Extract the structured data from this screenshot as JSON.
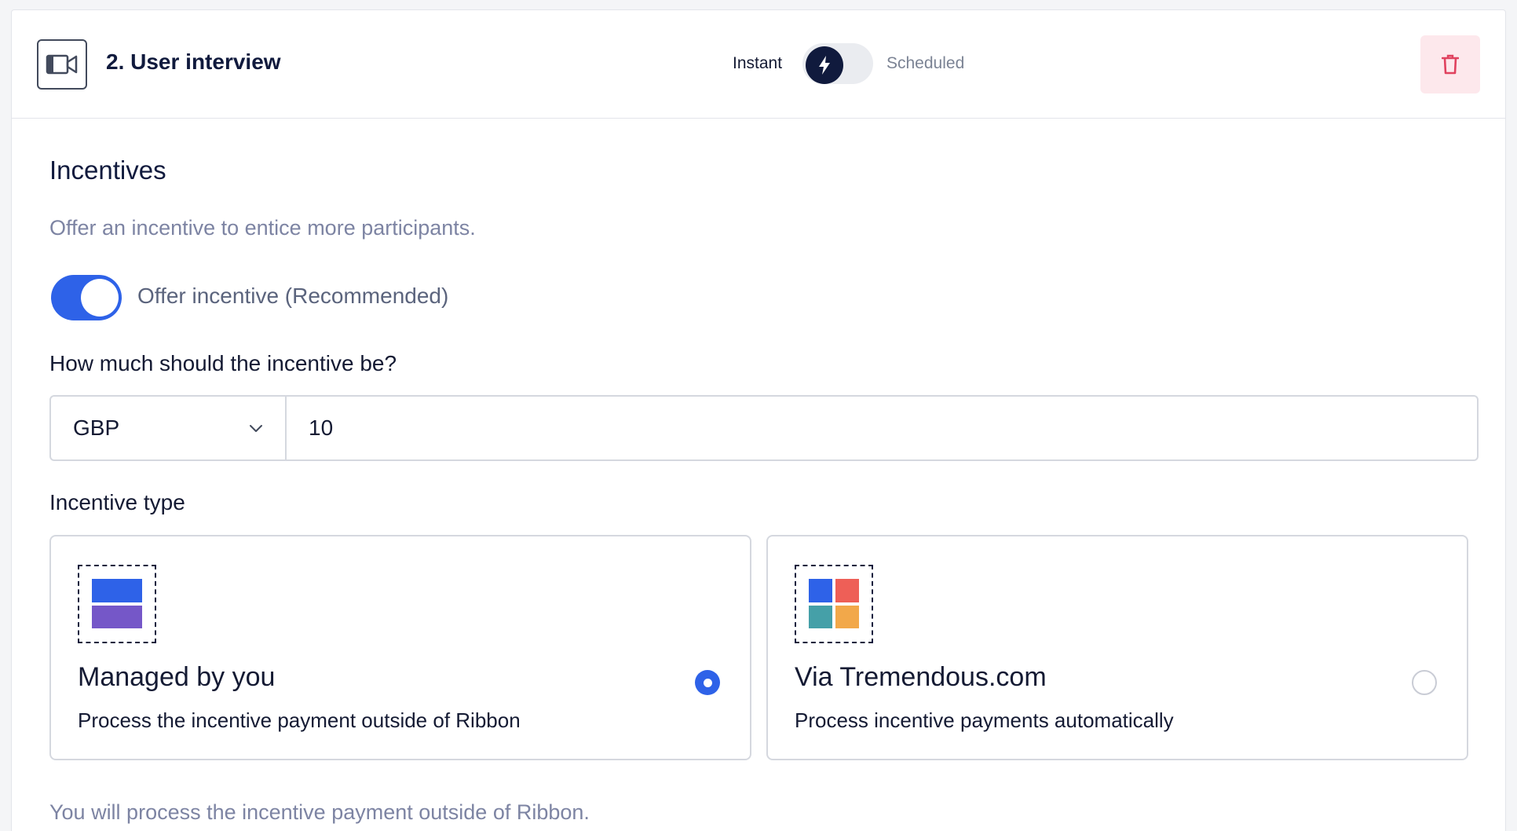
{
  "header": {
    "title": "2. User interview",
    "mode_instant": "Instant",
    "mode_scheduled": "Scheduled",
    "mode_selected": "Instant"
  },
  "incentives": {
    "title": "Incentives",
    "description": "Offer an incentive to entice more participants.",
    "toggle_label": "Offer incentive (Recommended)",
    "toggle_on": true,
    "amount_question": "How much should the incentive be?",
    "currency": "GBP",
    "amount": "10",
    "type_label": "Incentive type",
    "options": [
      {
        "name": "Managed by you",
        "description": "Process the incentive payment outside of Ribbon",
        "selected": true
      },
      {
        "name": "Via Tremendous.com",
        "description": "Process incentive payments automatically",
        "selected": false
      }
    ],
    "footnote": "You will process the incentive payment outside of Ribbon."
  },
  "colors": {
    "accent": "#2e62e8",
    "navy": "#101a3d",
    "danger": "#e0425f",
    "danger_bg": "#fde8ec"
  },
  "icons": {
    "header": "video-camera-icon",
    "mode": "lightning-bolt-icon",
    "delete": "trash-icon",
    "currency_dropdown": "chevron-down-icon",
    "option_managed": "stacked-blocks-icon",
    "option_tremendous": "four-squares-icon"
  }
}
